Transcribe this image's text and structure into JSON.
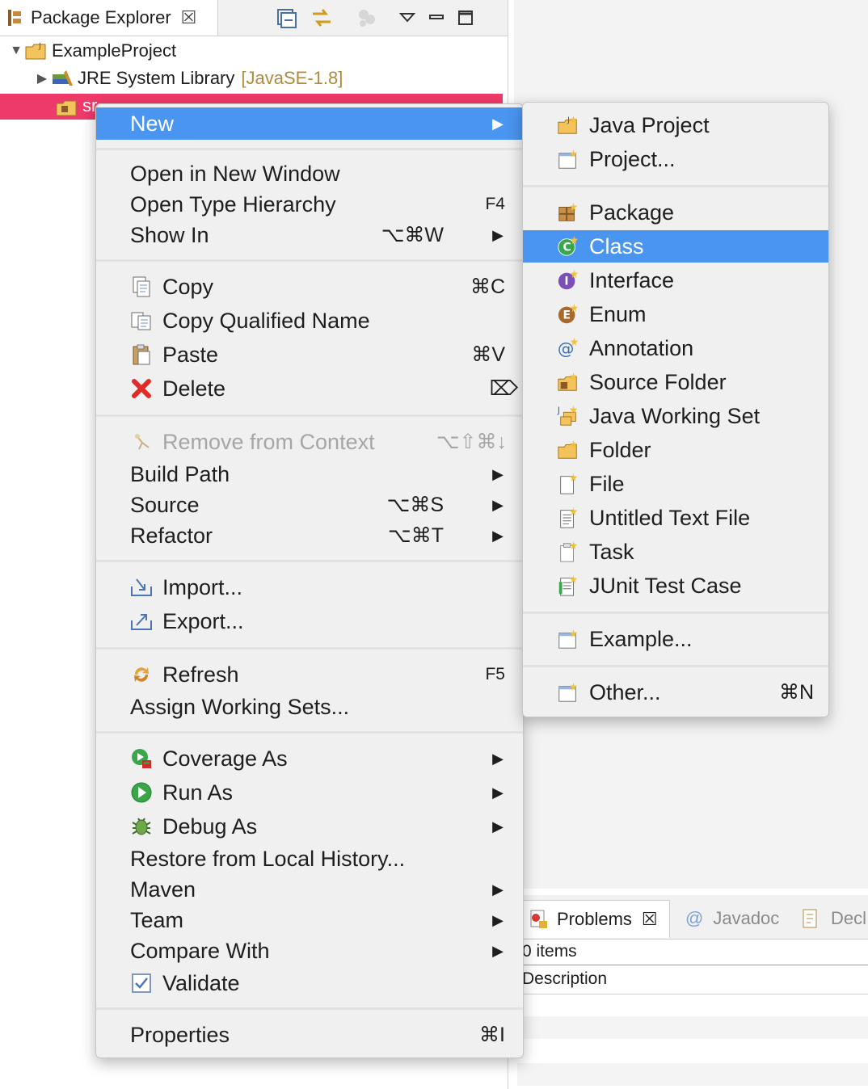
{
  "explorer": {
    "tab_title": "Package Explorer",
    "tree": {
      "project": "ExampleProject",
      "jre_label": "JRE System Library",
      "jre_version": "[JavaSE-1.8]",
      "selected_prefix": "sr"
    }
  },
  "context_menu": {
    "new": "New",
    "open_new_window": "Open in New Window",
    "open_type_hierarchy": "Open Type Hierarchy",
    "open_type_hierarchy_sc": "F4",
    "show_in": "Show In",
    "show_in_sc": "⌥⌘W",
    "copy": "Copy",
    "copy_sc": "⌘C",
    "copy_qualified": "Copy Qualified Name",
    "paste": "Paste",
    "paste_sc": "⌘V",
    "delete": "Delete",
    "delete_sc": "⌦",
    "remove_context": "Remove from Context",
    "remove_context_sc": "⌥⇧⌘↓",
    "build_path": "Build Path",
    "source": "Source",
    "source_sc": "⌥⌘S",
    "refactor": "Refactor",
    "refactor_sc": "⌥⌘T",
    "import": "Import...",
    "export": "Export...",
    "refresh": "Refresh",
    "refresh_sc": "F5",
    "assign_working_sets": "Assign Working Sets...",
    "coverage_as": "Coverage As",
    "run_as": "Run As",
    "debug_as": "Debug As",
    "restore_history": "Restore from Local History...",
    "maven": "Maven",
    "team": "Team",
    "compare_with": "Compare With",
    "validate": "Validate",
    "properties": "Properties",
    "properties_sc": "⌘I"
  },
  "submenu": {
    "java_project": "Java Project",
    "project": "Project...",
    "package": "Package",
    "class": "Class",
    "interface": "Interface",
    "enum": "Enum",
    "annotation": "Annotation",
    "source_folder": "Source Folder",
    "java_working_set": "Java Working Set",
    "folder": "Folder",
    "file": "File",
    "untitled_text_file": "Untitled Text File",
    "task": "Task",
    "junit_test_case": "JUnit Test Case",
    "example": "Example...",
    "other": "Other...",
    "other_sc": "⌘N"
  },
  "problems": {
    "tab_problems": "Problems",
    "tab_javadoc": "Javadoc",
    "tab_declaration": "Decl",
    "items": "0 items",
    "column_description": "Description"
  },
  "colors": {
    "menu_highlight": "#4a95f0",
    "selection_row": "#ee3a6a",
    "menu_bg": "#f0f0f0"
  }
}
